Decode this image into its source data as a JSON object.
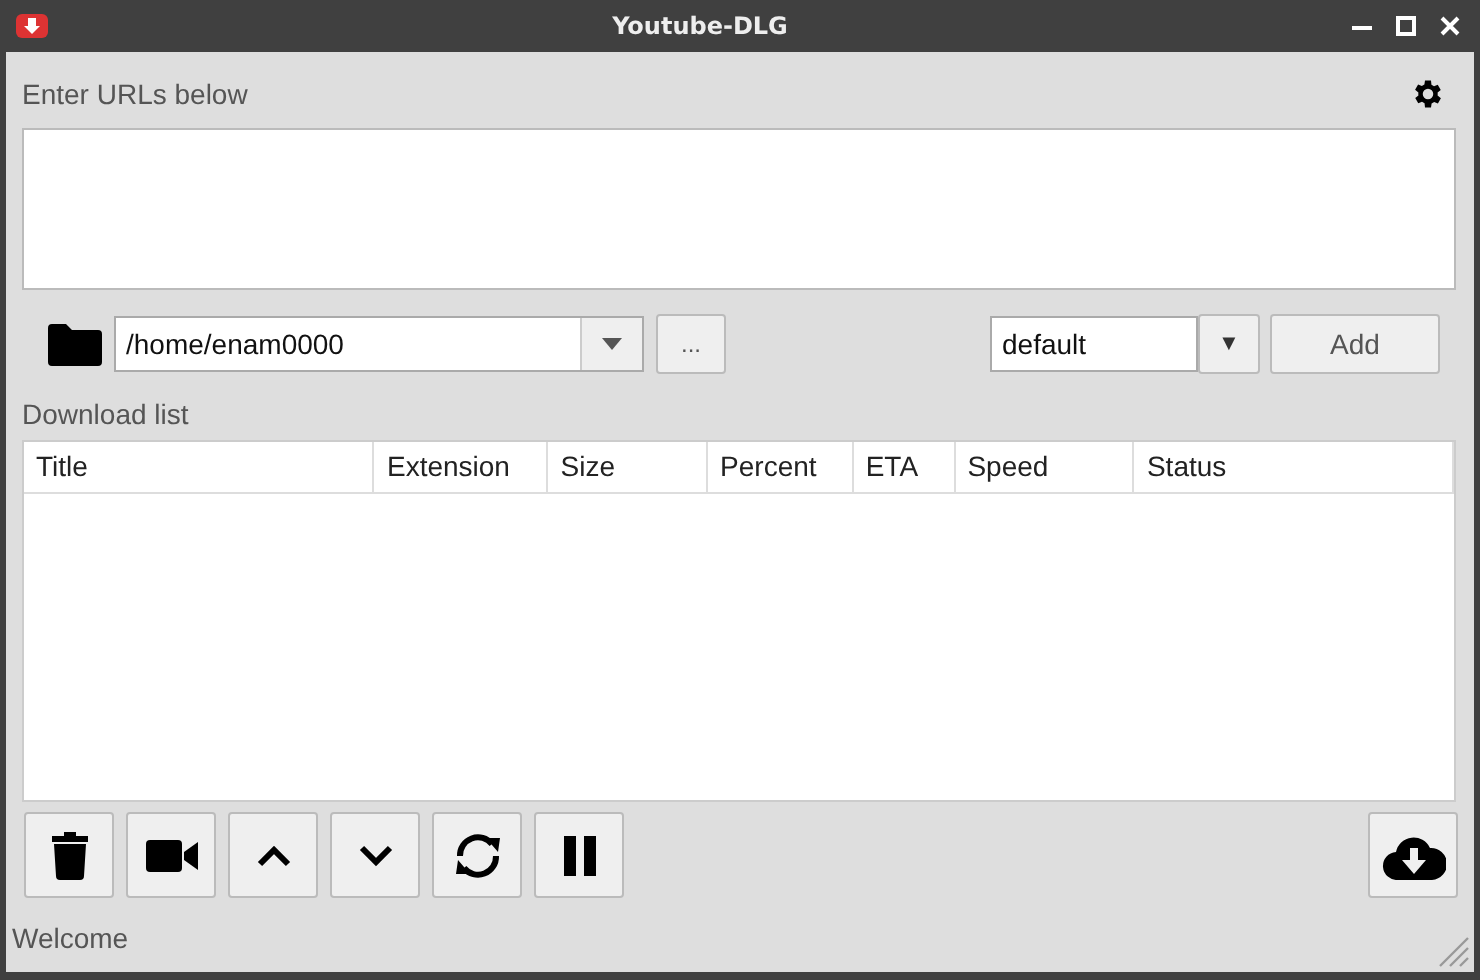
{
  "window": {
    "title": "Youtube-DLG"
  },
  "urls": {
    "label": "Enter URLs below"
  },
  "path": {
    "value": "/home/enam0000",
    "browse": "..."
  },
  "format": {
    "value": "default",
    "arrow": "▼",
    "add": "Add"
  },
  "download_list": {
    "label": "Download list",
    "columns": [
      "Title",
      "Extension",
      "Size",
      "Percent",
      "ETA",
      "Speed",
      "Status"
    ]
  },
  "status_bar": "Welcome"
}
